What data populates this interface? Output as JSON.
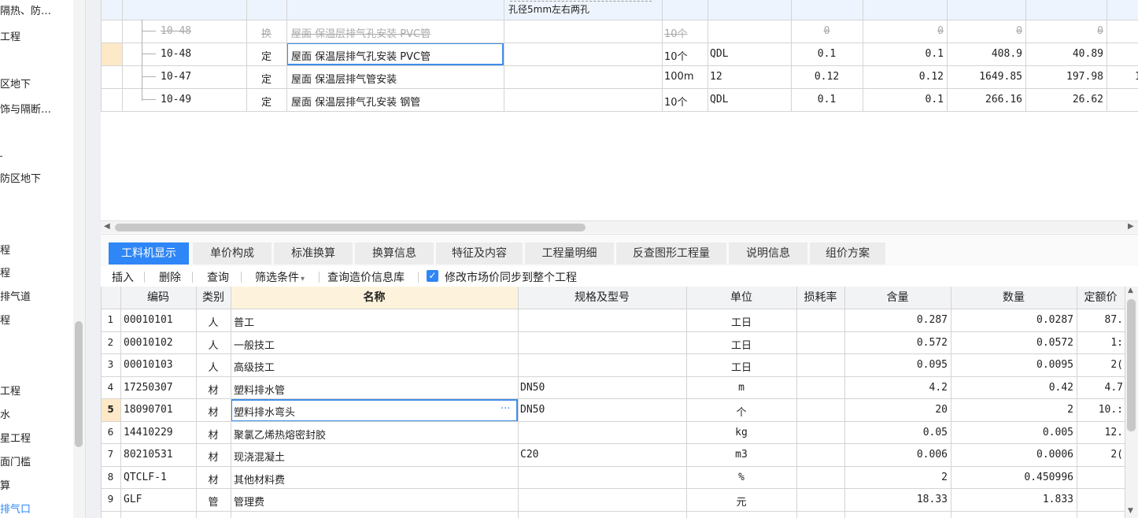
{
  "left_tree": [
    {
      "label": "隔热、防…",
      "active": false
    },
    {
      "label": "工程",
      "active": false
    },
    {
      "label": "区地下",
      "active": false
    },
    {
      "label": "饰与隔断…",
      "active": false
    },
    {
      "label": "防区地下",
      "active": false
    },
    {
      "label": "程",
      "active": false
    },
    {
      "label": "程",
      "active": false
    },
    {
      "label": "排气道",
      "active": false
    },
    {
      "label": "程",
      "active": false
    },
    {
      "label": "工程",
      "active": false
    },
    {
      "label": "水",
      "active": false
    },
    {
      "label": "星工程",
      "active": false
    },
    {
      "label": "面门槛",
      "active": false
    },
    {
      "label": "算",
      "active": false
    },
    {
      "label": "排气口",
      "active": true
    }
  ],
  "top_grid": {
    "partial_spec_text": "孔径5mm左右两孔",
    "rows": [
      {
        "code": "10-48",
        "type": "换",
        "name": "屋面 保温层排气孔安装 PVC管",
        "unit": "10个",
        "expr": "",
        "qty1": "0",
        "qty2": "0",
        "price": "0",
        "total": "0",
        "struck": true,
        "selected": false
      },
      {
        "code": "10-48",
        "type": "定",
        "name": "屋面 保温层排气孔安装 PVC管",
        "unit": "10个",
        "expr": "QDL",
        "qty1": "0.1",
        "qty2": "0.1",
        "price": "408.9",
        "total": "40.89",
        "struck": false,
        "selected": true
      },
      {
        "code": "10-47",
        "type": "定",
        "name": "屋面 保温层排气管安装",
        "unit": "100m",
        "expr": "12",
        "qty1": "0.12",
        "qty2": "0.12",
        "price": "1649.85",
        "total": "197.98",
        "extra": "1",
        "struck": false,
        "selected": false
      },
      {
        "code": "10-49",
        "type": "定",
        "name": "屋面 保温层排气孔安装 钢管",
        "unit": "10个",
        "expr": "QDL",
        "qty1": "0.1",
        "qty2": "0.1",
        "price": "266.16",
        "total": "26.62",
        "struck": false,
        "selected": false
      }
    ]
  },
  "tabs": [
    {
      "label": "工料机显示",
      "active": true
    },
    {
      "label": "单价构成",
      "active": false
    },
    {
      "label": "标准换算",
      "active": false
    },
    {
      "label": "换算信息",
      "active": false
    },
    {
      "label": "特征及内容",
      "active": false
    },
    {
      "label": "工程量明细",
      "active": false
    },
    {
      "label": "反查图形工程量",
      "active": false
    },
    {
      "label": "说明信息",
      "active": false
    },
    {
      "label": "组价方案",
      "active": false
    }
  ],
  "toolbar": {
    "insert": "插入",
    "delete": "删除",
    "query": "查询",
    "filter": "筛选条件",
    "filter_arrow": "▾",
    "query_price_db": "查询造价信息库",
    "sync_checkbox_label": "修改市场价同步到整个工程",
    "sync_checked": true
  },
  "bottom_grid": {
    "headers": {
      "code": "编码",
      "category": "类别",
      "name": "名称",
      "spec": "规格及型号",
      "unit": "单位",
      "loss": "损耗率",
      "content": "含量",
      "quantity": "数量",
      "base_price": "定额价"
    },
    "selected_row": 5,
    "rows": [
      {
        "no": "1",
        "code": "00010101",
        "category": "人",
        "name": "普工",
        "spec": "",
        "unit": "工日",
        "content": "0.287",
        "quantity": "0.0287",
        "price": "87."
      },
      {
        "no": "2",
        "code": "00010102",
        "category": "人",
        "name": "一般技工",
        "spec": "",
        "unit": "工日",
        "content": "0.572",
        "quantity": "0.0572",
        "price": "1:"
      },
      {
        "no": "3",
        "code": "00010103",
        "category": "人",
        "name": "高级技工",
        "spec": "",
        "unit": "工日",
        "content": "0.095",
        "quantity": "0.0095",
        "price": "2("
      },
      {
        "no": "4",
        "code": "17250307",
        "category": "材",
        "name": "塑料排水管",
        "spec": "DN50",
        "unit": "m",
        "content": "4.2",
        "quantity": "0.42",
        "price": "4.7"
      },
      {
        "no": "5",
        "code": "18090701",
        "category": "材",
        "name": "塑料排水弯头",
        "spec": "DN50",
        "unit": "个",
        "content": "20",
        "quantity": "2",
        "price": "10.:"
      },
      {
        "no": "6",
        "code": "14410229",
        "category": "材",
        "name": "聚氯乙烯热熔密封胶",
        "spec": "",
        "unit": "kg",
        "content": "0.05",
        "quantity": "0.005",
        "price": "12."
      },
      {
        "no": "7",
        "code": "80210531",
        "category": "材",
        "name": "现浇混凝土",
        "spec": "C20",
        "unit": "m3",
        "content": "0.006",
        "quantity": "0.0006",
        "price": "2("
      },
      {
        "no": "8",
        "code": "QTCLF-1",
        "category": "材",
        "name": "其他材料费",
        "spec": "",
        "unit": "%",
        "content": "2",
        "quantity": "0.450996",
        "price": ""
      },
      {
        "no": "9",
        "code": "GLF",
        "category": "管",
        "name": "管理费",
        "spec": "",
        "unit": "元",
        "content": "18.33",
        "quantity": "1.833",
        "price": ""
      }
    ],
    "ellipsis": "···"
  }
}
